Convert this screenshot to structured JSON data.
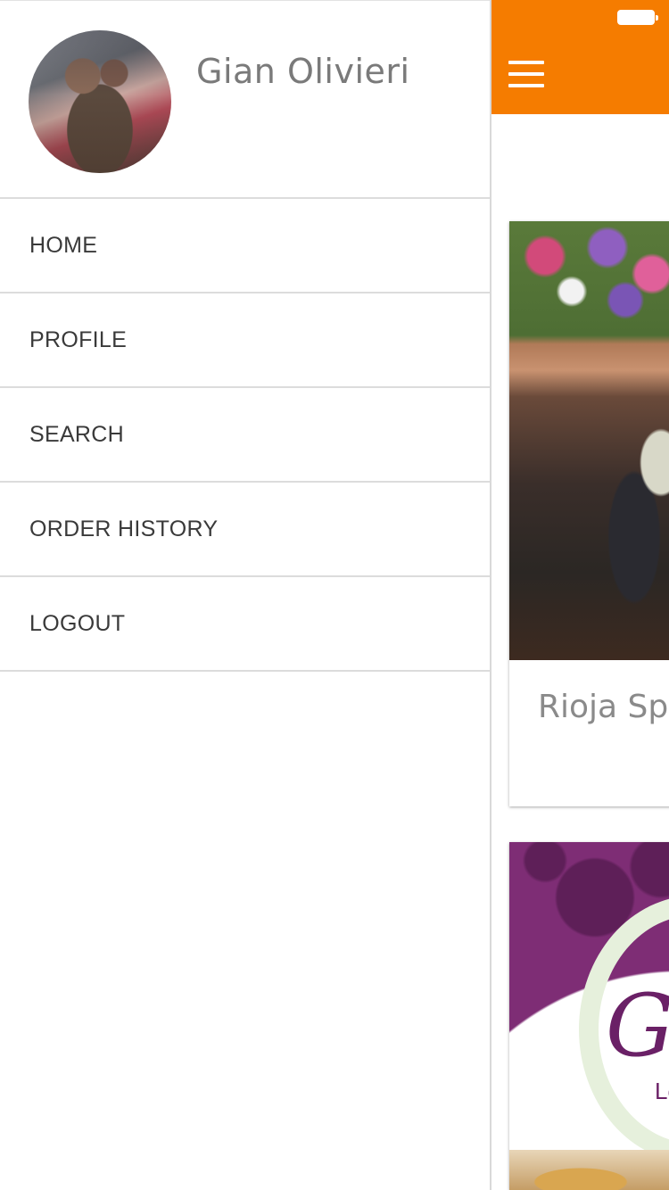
{
  "drawer": {
    "user_name": "Gian Olivieri",
    "menu": [
      {
        "label": "HOME"
      },
      {
        "label": "PROFILE"
      },
      {
        "label": "SEARCH"
      },
      {
        "label": "ORDER HISTORY"
      },
      {
        "label": "LOGOUT"
      }
    ]
  },
  "header": {
    "menu_icon": "hamburger-menu-icon",
    "accent_color": "#f57c00"
  },
  "restaurants": [
    {
      "name": "Rioja Spa"
    },
    {
      "name": "G",
      "sub": "Lo"
    }
  ]
}
